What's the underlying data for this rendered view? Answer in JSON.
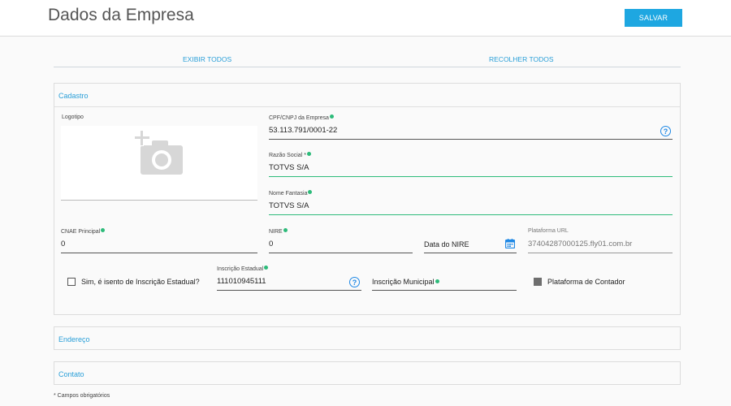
{
  "header": {
    "title": "Dados da Empresa",
    "save_label": "SALVAR"
  },
  "toggles": {
    "expand_all": "EXIBIR TODOS",
    "collapse_all": "RECOLHER TODOS"
  },
  "sections": {
    "cadastro": "Cadastro",
    "endereco": "Endereço",
    "contato": "Contato"
  },
  "form": {
    "logo_label": "Logotipo",
    "cnpj": {
      "label": "CPF/CNPJ da Empresa",
      "value": "53.113.791/0001-22"
    },
    "razao_social": {
      "label": "Razão Social *",
      "value": "TOTVS S/A"
    },
    "nome_fantasia": {
      "label": "Nome Fantasia",
      "value": "TOTVS S/A"
    },
    "cnae": {
      "label": "CNAE Principal",
      "value": "0"
    },
    "nire": {
      "label": "NIRE",
      "value": "0"
    },
    "data_nire": {
      "placeholder": "Data do NIRE"
    },
    "plataforma_url": {
      "label": "Plataforma URL",
      "value": "37404287000125.fly01.com.br"
    },
    "isento_label": "Sim, é isento de Inscrição Estadual?",
    "inscricao_estadual": {
      "label": "Inscrição Estadual",
      "value": "111010945111"
    },
    "inscricao_municipal": {
      "placeholder": "Inscrição Municipal"
    },
    "plataforma_contador_label": "Plataforma de Contador"
  },
  "footer": {
    "note": "* Campos obrigatórios"
  },
  "icons": {
    "camera": "camera-add-icon",
    "help": "help-circle-icon",
    "calendar": "calendar-icon",
    "required": "required-dot-icon"
  },
  "colors": {
    "accent": "#1ea7e1",
    "link": "#2a9fd8",
    "required": "#2dbb7a",
    "help": "#1e88e5"
  }
}
